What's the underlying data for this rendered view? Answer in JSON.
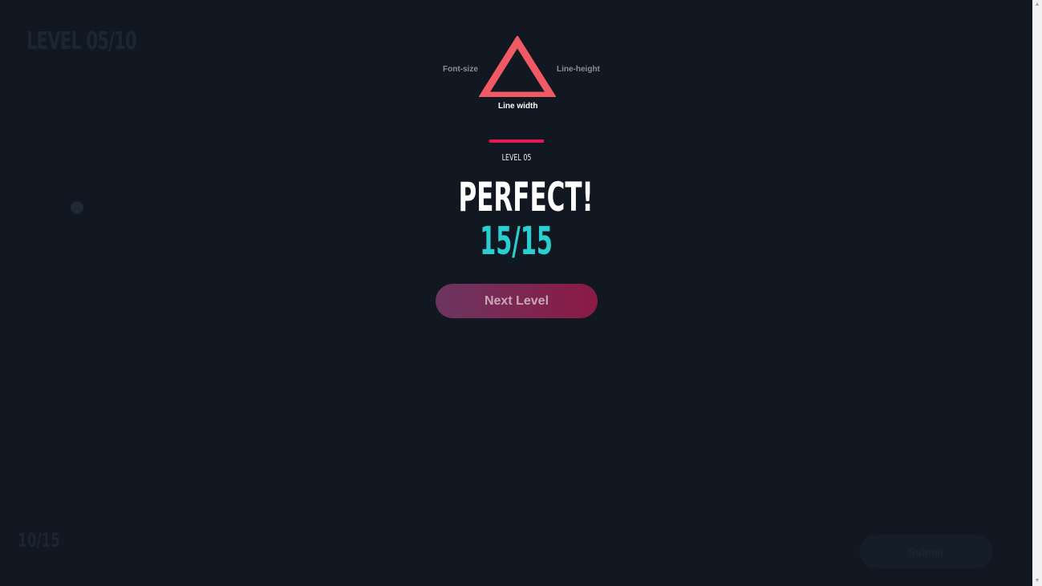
{
  "background": {
    "level_title": "LEVEL 05/10",
    "score": "10/15",
    "button_label": "Submit"
  },
  "modal": {
    "triangle_labels": {
      "font_size": "Font-size",
      "line_height": "Line-height",
      "line_width": "Line width"
    },
    "level_label": "LEVEL 05",
    "result_title": "PERFECT!",
    "score": "15/15",
    "next_button": "Next Level"
  },
  "colors": {
    "background": "#111822",
    "triangle": "#f05a64",
    "accent": "#e4194f",
    "score": "#29cfd0",
    "button_gradient_start": "#6b3560",
    "button_gradient_end": "#8b1a45"
  },
  "icons": {
    "triangle": "triangle-outline-icon",
    "scroll_up": "scroll-up-arrow-icon",
    "scroll_down": "scroll-down-arrow-icon"
  }
}
